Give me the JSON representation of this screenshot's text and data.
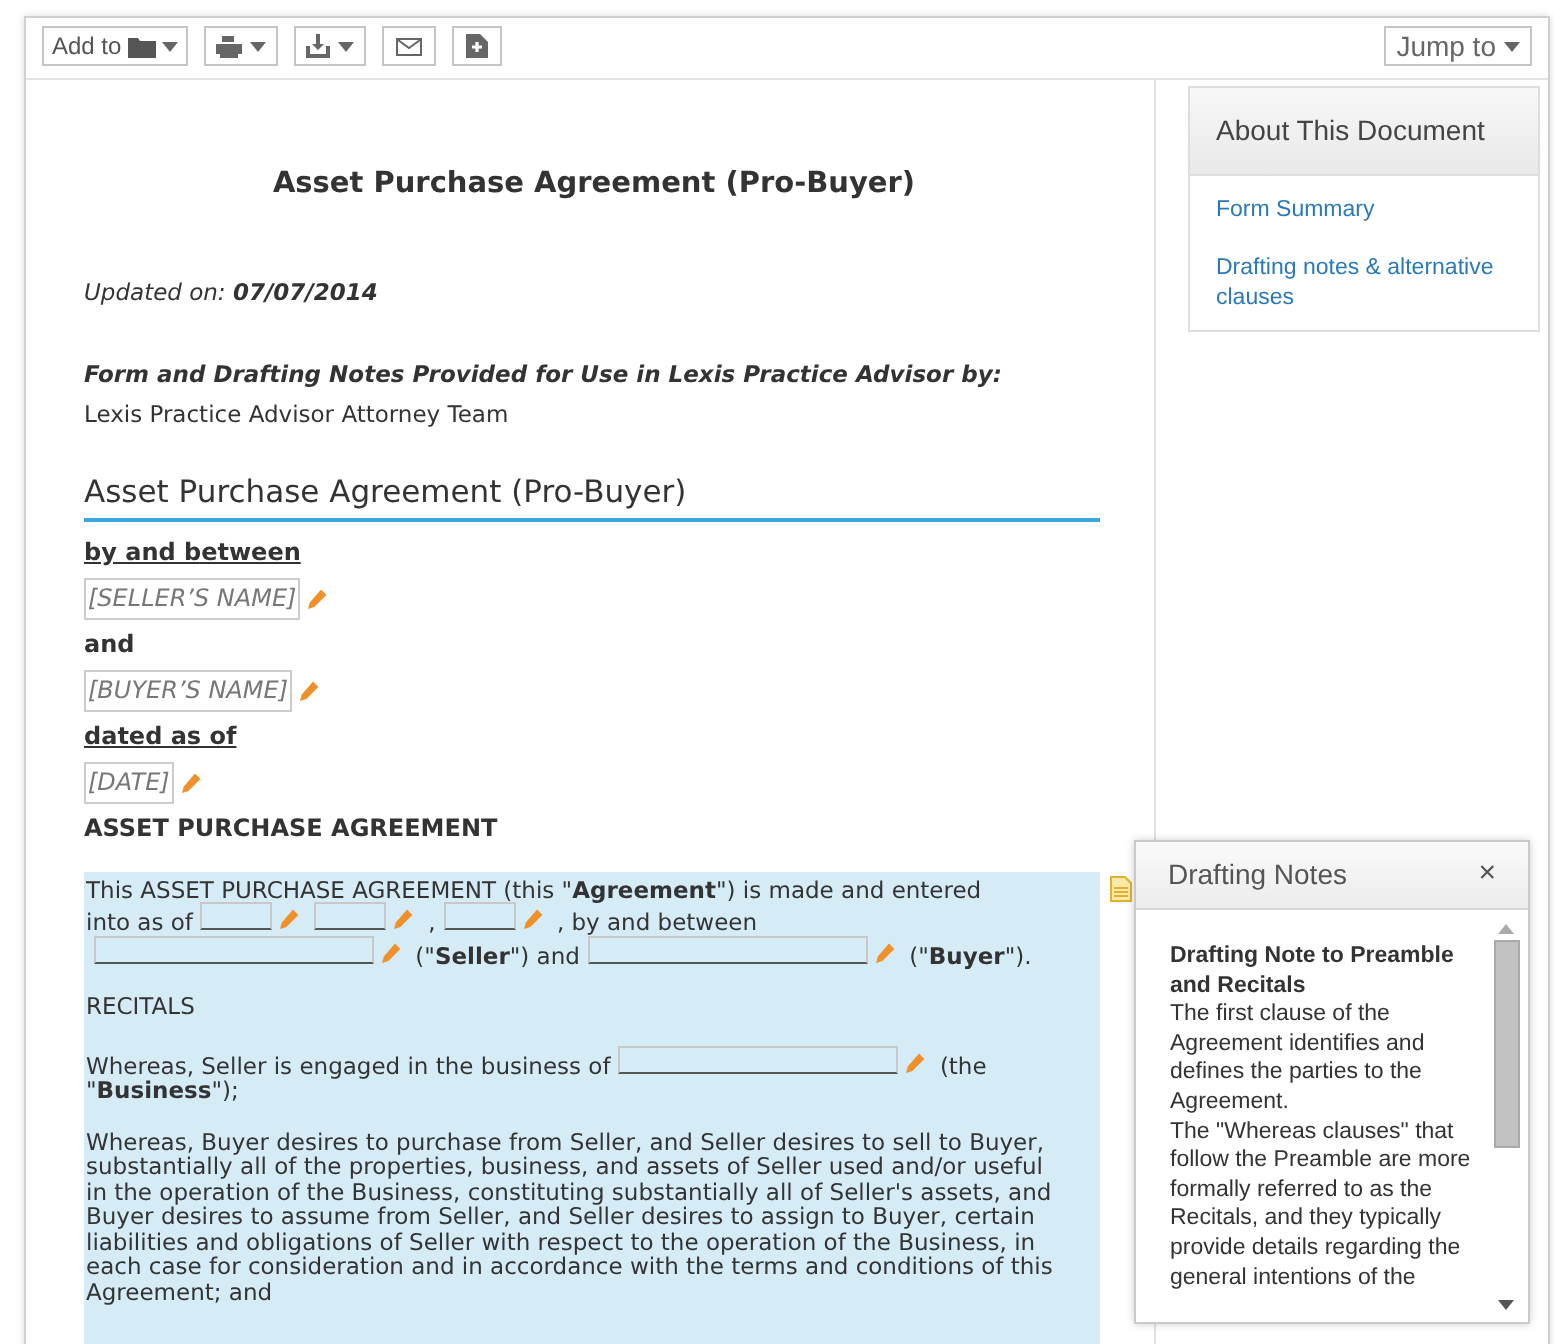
{
  "toolbar": {
    "add_to": "Add to",
    "jump_to": "Jump to"
  },
  "document": {
    "title": "Asset Purchase Agreement (Pro-Buyer)",
    "updated_label": "Updated on:",
    "updated_date": "07/07/2014",
    "provided_by": "Form and Drafting Notes Provided for Use in Lexis Practice Advisor by:",
    "author": "Lexis Practice Advisor Attorney Team",
    "heading": "Asset Purchase Agreement (Pro-Buyer)",
    "parties": [
      {
        "kind": "label",
        "text": "by and between"
      },
      {
        "kind": "field",
        "text": "[SELLER’S NAME]"
      },
      {
        "kind": "plain",
        "text": "and"
      },
      {
        "kind": "field",
        "text": "[BUYER’S NAME]"
      },
      {
        "kind": "label",
        "text": "dated as of"
      },
      {
        "kind": "field",
        "text": "[DATE]"
      },
      {
        "kind": "plain",
        "text": "ASSET PURCHASE AGREEMENT"
      }
    ],
    "body": {
      "highlighted": true,
      "paragraphs": [
        {
          "segments": [
            {
              "kind": "text",
              "text": "This ASSET PURCHASE AGREEMENT (this \"**Agreement**\") is made and entered"
            },
            {
              "kind": "text",
              "text": "into as of"
            },
            {
              "kind": "blank"
            },
            {
              "kind": "blank"
            },
            {
              "kind": "text",
              "text": ","
            },
            {
              "kind": "blank"
            },
            {
              "kind": "text",
              "text": ", by and between"
            },
            {
              "kind": "line"
            },
            {
              "kind": "text",
              "text": "(\"**Seller**\") and"
            },
            {
              "kind": "line"
            },
            {
              "kind": "text",
              "text": "(\"**Buyer**\")."
            }
          ]
        },
        {
          "segments": [
            {
              "kind": "text",
              "text": "RECITALS"
            }
          ]
        },
        {
          "segments": [
            {
              "kind": "text",
              "text": "Whereas, Seller is engaged in the business of"
            },
            {
              "kind": "line"
            },
            {
              "kind": "text",
              "text": "(the"
            },
            {
              "kind": "text",
              "text": "\"**Business**\");"
            }
          ]
        },
        {
          "segments": [
            {
              "kind": "text",
              "text": "Whereas, Buyer desires to purchase from Seller, and Seller desires to sell to Buyer, substantially all of the properties, business, and assets of Seller used and/or useful in the operation of the Business, constituting substantially all of Seller's assets, and Buyer desires to assume from Seller, and Seller desires to assign to Buyer, certain liabilities and obligations of Seller with respect to the operation of the Business, in each case for consideration and in accordance with the terms and conditions of this Agreement; and"
            }
          ]
        }
      ]
    }
  },
  "sidebar": {
    "title": "About This Document",
    "links": [
      "Form Summary",
      "Drafting notes & alternative clauses"
    ]
  },
  "drafting_notes": {
    "title": "Drafting Notes",
    "close": "×",
    "note_title": "Drafting Note to Preamble and Recitals",
    "paragraphs": [
      "The first clause of the Agreement identifies and defines the parties to the Agreement.",
      "The \"Whereas clauses\" that follow the Preamble are more formally referred to as the Recitals, and they typically provide details regarding the general intentions of the"
    ]
  }
}
